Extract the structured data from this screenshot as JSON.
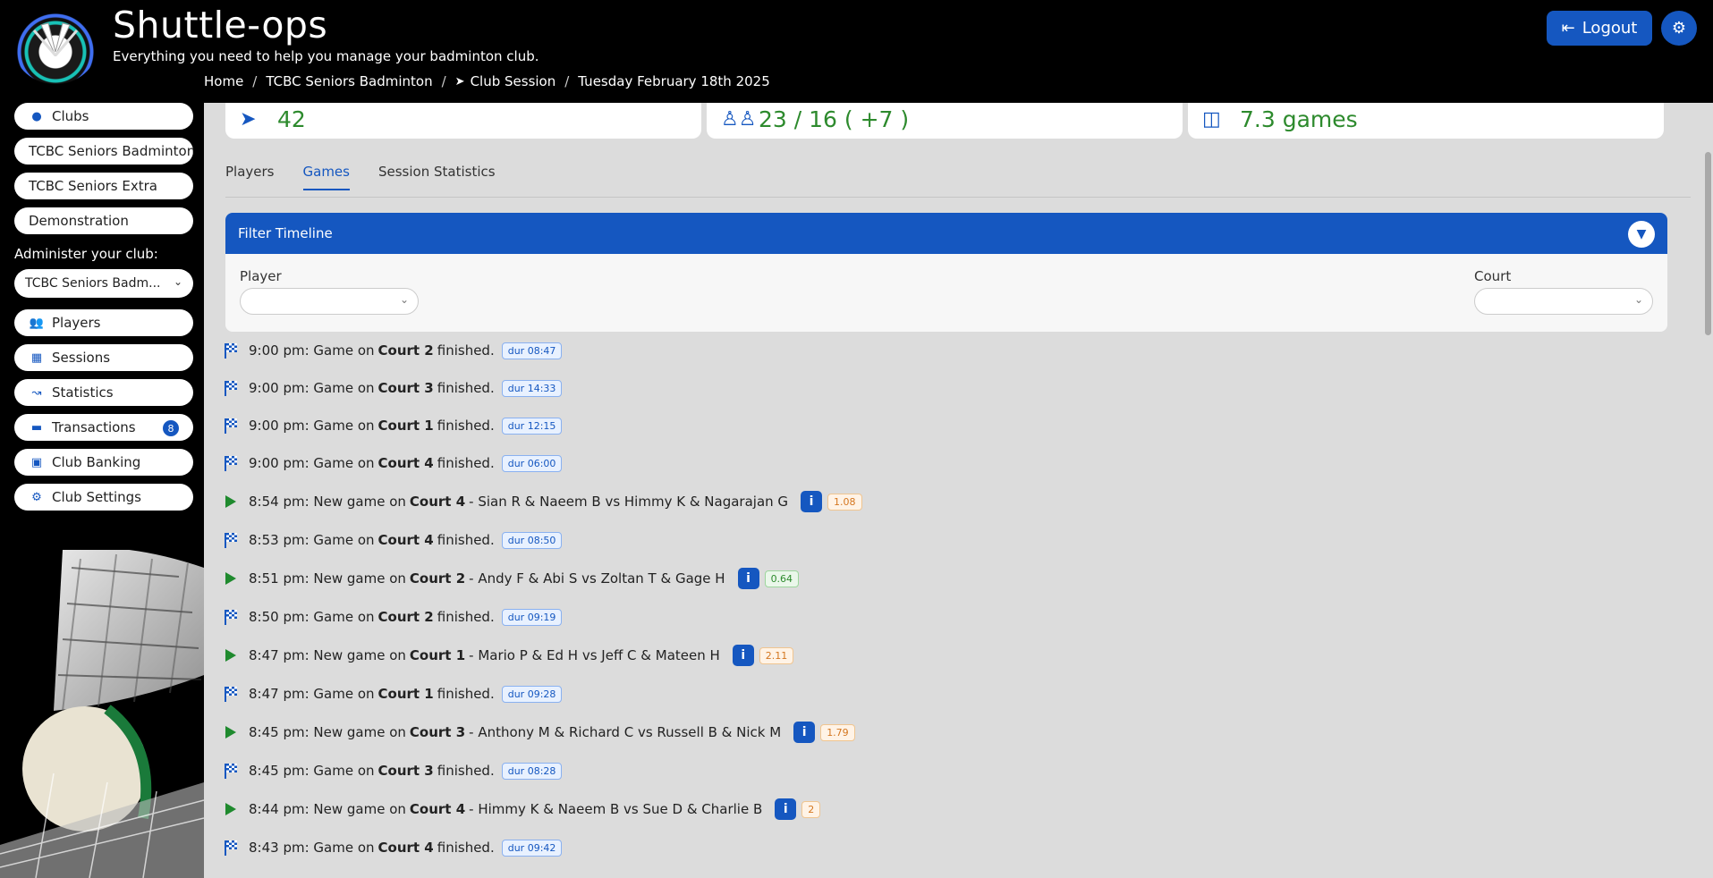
{
  "header": {
    "title": "Shuttle-ops",
    "subtitle": "Everything you need to help you manage your badminton club.",
    "logout_label": "Logout",
    "breadcrumb": [
      "Home",
      "TCBC Seniors Badminton",
      "Club Session",
      "Tuesday February 18th 2025"
    ]
  },
  "sidebar": {
    "club_links": [
      "Clubs",
      "TCBC Seniors Badminton",
      "TCBC Seniors Extra",
      "Demonstration"
    ],
    "admin_label": "Administer your club:",
    "admin_select": "TCBC Seniors Badm...",
    "menu": [
      {
        "label": "Players",
        "icon": "users-icon"
      },
      {
        "label": "Sessions",
        "icon": "calendar-icon"
      },
      {
        "label": "Statistics",
        "icon": "chart-icon"
      },
      {
        "label": "Transactions",
        "icon": "card-icon",
        "badge": "8"
      },
      {
        "label": "Club Banking",
        "icon": "wallet-icon"
      },
      {
        "label": "Club Settings",
        "icon": "gear-icon"
      }
    ]
  },
  "stats": [
    "42",
    "23 / 16 ( +7 )",
    "7.3 games"
  ],
  "tabs": [
    "Players",
    "Games",
    "Session Statistics"
  ],
  "active_tab": "Games",
  "filter": {
    "title": "Filter Timeline",
    "player_label": "Player",
    "court_label": "Court"
  },
  "timeline": [
    {
      "type": "finished",
      "time": "9:00 pm: Game on",
      "court": "Court 2",
      "tail": "finished.",
      "dur": "dur 08:47"
    },
    {
      "type": "finished",
      "time": "9:00 pm: Game on",
      "court": "Court 3",
      "tail": "finished.",
      "dur": "dur 14:33"
    },
    {
      "type": "finished",
      "time": "9:00 pm: Game on",
      "court": "Court 1",
      "tail": "finished.",
      "dur": "dur 12:15"
    },
    {
      "type": "finished",
      "time": "9:00 pm: Game on",
      "court": "Court 4",
      "tail": "finished.",
      "dur": "dur 06:00"
    },
    {
      "type": "new",
      "time": "8:54 pm: New game on",
      "court": "Court 4",
      "tail": "- Sian R & Naeem B vs Himmy K & Nagarajan G",
      "rating": "1.08",
      "rating_color": "orange"
    },
    {
      "type": "finished",
      "time": "8:53 pm: Game on",
      "court": "Court 4",
      "tail": "finished.",
      "dur": "dur 08:50"
    },
    {
      "type": "new",
      "time": "8:51 pm: New game on",
      "court": "Court 2",
      "tail": "- Andy F & Abi S vs Zoltan T & Gage H",
      "rating": "0.64",
      "rating_color": "green"
    },
    {
      "type": "finished",
      "time": "8:50 pm: Game on",
      "court": "Court 2",
      "tail": "finished.",
      "dur": "dur 09:19"
    },
    {
      "type": "new",
      "time": "8:47 pm: New game on",
      "court": "Court 1",
      "tail": "- Mario P & Ed H vs Jeff C & Mateen H",
      "rating": "2.11",
      "rating_color": "orange"
    },
    {
      "type": "finished",
      "time": "8:47 pm: Game on",
      "court": "Court 1",
      "tail": "finished.",
      "dur": "dur 09:28"
    },
    {
      "type": "new",
      "time": "8:45 pm: New game on",
      "court": "Court 3",
      "tail": "- Anthony M & Richard C vs Russell B & Nick M",
      "rating": "1.79",
      "rating_color": "orange"
    },
    {
      "type": "finished",
      "time": "8:45 pm: Game on",
      "court": "Court 3",
      "tail": "finished.",
      "dur": "dur 08:28"
    },
    {
      "type": "new",
      "time": "8:44 pm: New game on",
      "court": "Court 4",
      "tail": "- Himmy K & Naeem B vs Sue D & Charlie B",
      "rating": "2",
      "rating_color": "orange"
    },
    {
      "type": "finished",
      "time": "8:43 pm: Game on",
      "court": "Court 4",
      "tail": "finished.",
      "dur": "dur 09:42"
    }
  ]
}
